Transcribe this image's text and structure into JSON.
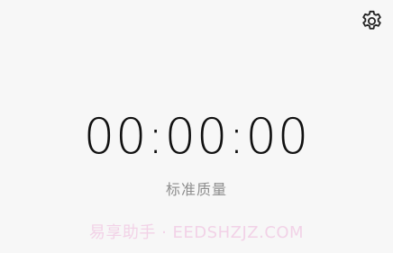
{
  "header": {
    "settings_icon": "gear-icon"
  },
  "timer": {
    "display": "00:00:00"
  },
  "quality": {
    "label": "标准质量"
  },
  "watermark": {
    "text": "易享助手 · EEDSHZJZ.COM"
  }
}
